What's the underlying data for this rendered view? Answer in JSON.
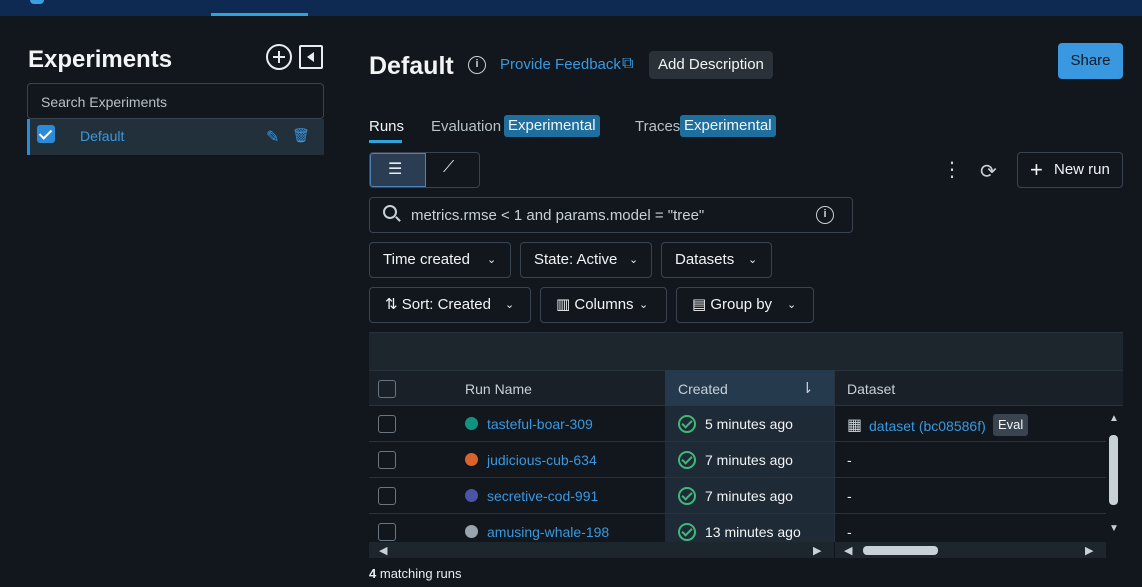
{
  "sidebar": {
    "title": "Experiments",
    "search_placeholder": "Search Experiments",
    "items": [
      {
        "label": "Default",
        "checked": true
      }
    ]
  },
  "header": {
    "title": "Default",
    "feedback_link": "Provide Feedback",
    "add_description": "Add Description",
    "share": "Share"
  },
  "tabs": [
    {
      "label": "Runs",
      "active": true
    },
    {
      "label": "Evaluation",
      "badge": "Experimental"
    },
    {
      "label": "Traces",
      "badge": "Experimental"
    }
  ],
  "toolbar": {
    "new_run": "New run",
    "search_query": "metrics.rmse < 1 and params.model = \"tree\"",
    "filters": [
      "Time created",
      "State: Active",
      "Datasets"
    ],
    "sort": "Sort: Created",
    "columns": "Columns",
    "group_by": "Group by"
  },
  "table": {
    "headers": {
      "run_name": "Run Name",
      "created": "Created",
      "dataset": "Dataset"
    },
    "rows": [
      {
        "name": "tasteful-boar-309",
        "color": "#12937f",
        "created": "5 minutes ago",
        "dataset": "dataset (bc08586f)",
        "tag": "Eval"
      },
      {
        "name": "judicious-cub-634",
        "color": "#d9632a",
        "created": "7 minutes ago",
        "dataset": "-"
      },
      {
        "name": "secretive-cod-991",
        "color": "#4b55a8",
        "created": "7 minutes ago",
        "dataset": "-"
      },
      {
        "name": "amusing-whale-198",
        "color": "#9aa4ad",
        "created": "13 minutes ago",
        "dataset": "-"
      }
    ]
  },
  "footer": {
    "count": "4",
    "count_label": "matching runs"
  },
  "icons": {
    "add": "plus-circle-icon",
    "collapse": "sidebar-collapse-icon",
    "info": "info-icon",
    "external": "external-link-icon",
    "list": "list-view-icon",
    "chart": "chart-view-icon",
    "kebab": "kebab-icon",
    "refresh": "refresh-icon",
    "search": "search-icon",
    "edit": "pencil-icon",
    "delete": "trash-icon",
    "sort": "sort-icon",
    "columns": "columns-icon",
    "group": "group-icon",
    "table": "table-icon",
    "status": "check-circle-icon"
  }
}
